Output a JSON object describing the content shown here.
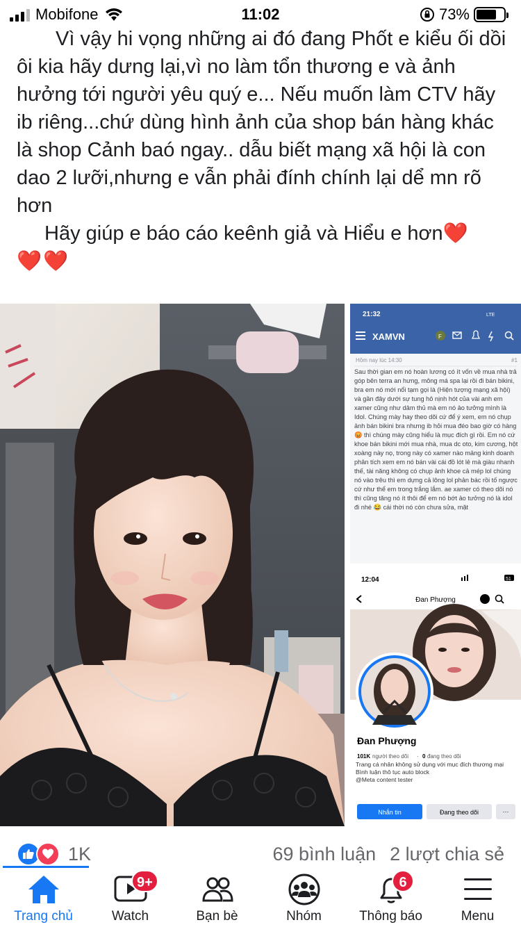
{
  "status_bar": {
    "carrier": "Mobifone",
    "time": "11:02",
    "battery_percent": "73%",
    "battery_level": 0.73
  },
  "post": {
    "paragraph_1": "Vì vậy hi vọng những ai đó đang Phốt e kiểu ối dồi ôi kia hãy dưng lại,vì no làm tổn thương e và ảnh hưởng tới người yêu quý e... Nếu muốn làm CTV hãy ib riêng...chứ dùng hình ảnh của shop bán hàng khác là shop Cảnh baó ngay.. dẫu biết mạng xã hội là con dao 2 lưỡi,nhưng e vẫn phải đính chính lại dể mn rõ hơn",
    "paragraph_2": "Hãy giúp e báo cáo keênh giả và Hiểu e hơn",
    "hearts_inline": "❤️",
    "hearts_line": "❤️❤️"
  },
  "screenshot_forum": {
    "time": "21:32",
    "status_icons": "LTE",
    "site_name": "XAMVN",
    "avatar_letter": "F",
    "post_time": "Hôm nay lúc 14:30",
    "post_number": "#1",
    "post_body": "Sau thời gian em nó hoàn lương có ít vốn về mua nhà trả góp bên terra an hưng, mông má spa lại rồi đi bán bikini, bra em nó mới nổi tạm gọi là (Hiện tượng mạng xã hội) và gần đây dưới sự tung hô nịnh hót của vài anh em xamer cũng như dâm thủ mà em nó ảo tưởng mình là Idol. Chúng mày hay theo dõi cứ để ý xem, em nó chụp ảnh bán bikini bra nhưng ib hỏi mua đéo bao giờ có hàng 😡 thì chúng mày cũng hiểu là mục đích gì rồi. Em nó cứ khoe bán bikini mới mua nhà, mua dc oto, kim cương, hột xoàng này nọ, trong này có xamer nào mảng kinh doanh phân tích xem em nó bán vài cái đồ lót lẻ mà giàu nhanh thế, tài năng không có chụp ảnh khoe cả mép lol chúng nó vào trêu thì em dựng cả lông lol phản bác rồi tố ngược cứ như thể em trong trắng lắm. ae xamer có theo dõi nó thì cũng tăng nó ít thôi để em nó bớt ảo tưởng nó là idol đi nhé 😂 cái thời nó còn chưa sửa, mặt"
  },
  "screenshot_profile": {
    "time": "12:04",
    "battery": "51",
    "profile_title": "Đan Phượng",
    "name": "Đan Phượng",
    "followers_count": "101K",
    "followers_label": "người theo dõi",
    "following_count": "0",
    "following_label": "đang theo dõi",
    "bio_1": "Trang cá nhân không sử dụng với mục đích thương mại",
    "bio_2": "Bình luận thô tục auto block",
    "bio_3": "@Meta content tester",
    "message_button": "Nhắn tin",
    "following_button": "Đang theo dõi",
    "more_button": "···"
  },
  "reactions": {
    "count": "1K",
    "comments": "69 bình luận",
    "shares": "2 lượt chia sẻ"
  },
  "nav": {
    "items": [
      {
        "label": "Trang chủ",
        "icon": "home-icon",
        "active": true
      },
      {
        "label": "Watch",
        "icon": "watch-icon",
        "badge": "9+"
      },
      {
        "label": "Bạn bè",
        "icon": "friends-icon"
      },
      {
        "label": "Nhóm",
        "icon": "groups-icon"
      },
      {
        "label": "Thông báo",
        "icon": "bell-icon",
        "badge": "6"
      },
      {
        "label": "Menu",
        "icon": "menu-icon"
      }
    ]
  },
  "colors": {
    "accent": "#1877f2",
    "badge": "#e41e3f",
    "heart": "#e0242c",
    "forum_header": "#3a63a8"
  }
}
